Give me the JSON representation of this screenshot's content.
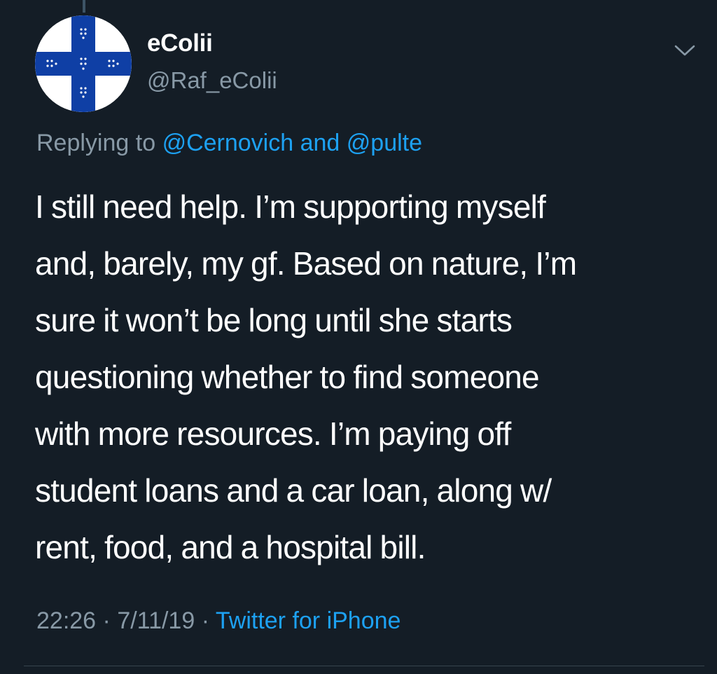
{
  "tweet": {
    "display_name": "eColii",
    "handle": "@Raf_eColii",
    "reply": {
      "prefix": "Replying to",
      "mention_1": "@Cernovich",
      "conjunction": "and",
      "mention_2": "@pulte"
    },
    "body_lines": [
      "I still need help. I’m supporting myself",
      "and, barely, my gf. Based on nature, I’m",
      "sure it won’t be long until she starts",
      "questioning whether to find someone",
      "with more resources. I’m paying off",
      "student loans and a car loan, along w/",
      "rent, food, and a hospital bill."
    ],
    "time": "22:26",
    "date": "7/11/19",
    "separator": "·",
    "source": "Twitter for iPhone"
  },
  "icons": {
    "avatar": "blue-cross-flag-avatar",
    "menu": "chevron-down-icon"
  },
  "colors": {
    "background": "#141d26",
    "secondary_text": "#8899a6",
    "link": "#1da1f2",
    "avatar_cross": "#0f3fa5"
  }
}
